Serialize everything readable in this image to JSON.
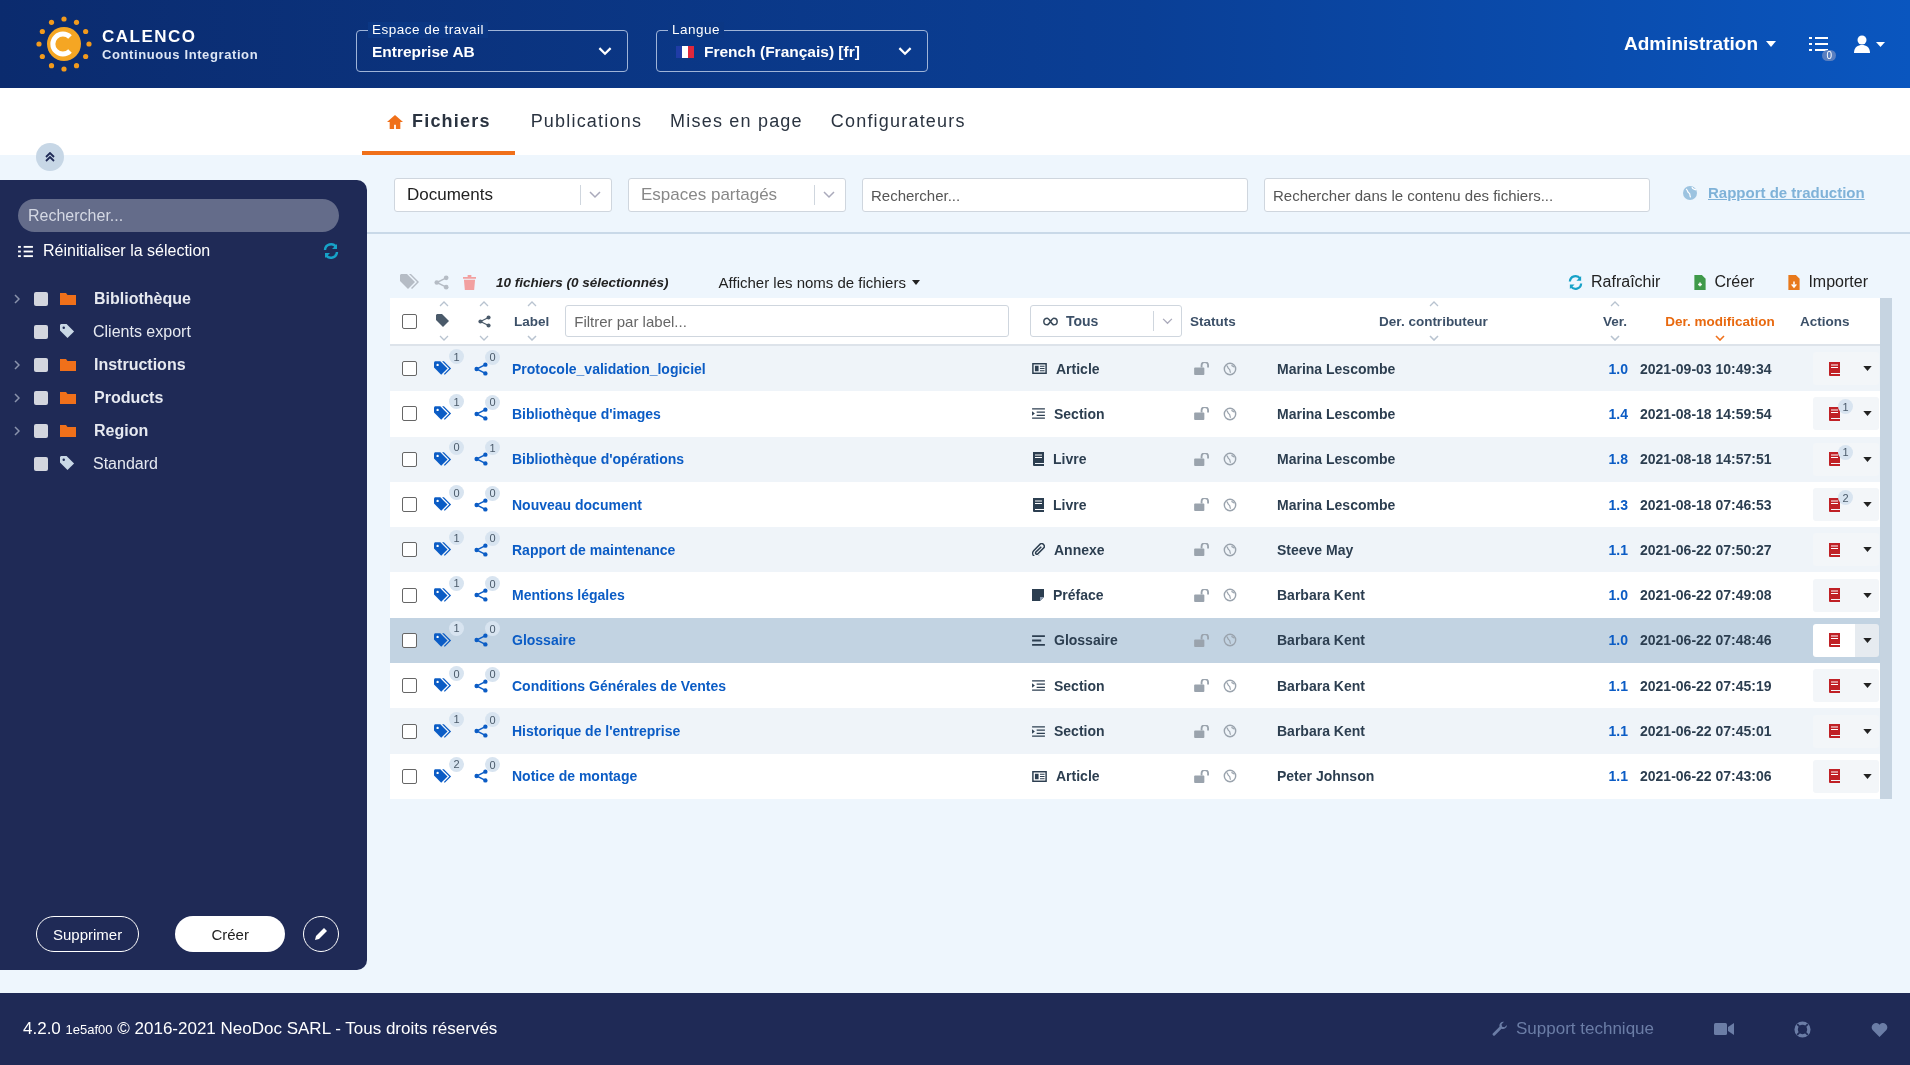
{
  "header": {
    "logo": {
      "name": "CALENCO",
      "subtitle": "Continuous Integration"
    },
    "workspace": {
      "label": "Espace de travail",
      "value": "Entreprise AB"
    },
    "language": {
      "label": "Langue",
      "value": "French (Français) [fr]"
    },
    "admin": "Administration",
    "tasks_count": "0"
  },
  "tabs": [
    {
      "label": "Fichiers",
      "selected": true,
      "kind": "home"
    },
    {
      "label": "Publications",
      "selected": false,
      "kind": "plain"
    },
    {
      "label": "Mises en page",
      "selected": false,
      "kind": "plain"
    },
    {
      "label": "Configurateurs",
      "selected": false,
      "kind": "plain"
    }
  ],
  "sidebar": {
    "search_placeholder": "Rechercher...",
    "reset": "Réinitialiser la sélection",
    "items": [
      {
        "label": "Bibliothèque",
        "kind": "folder",
        "expandable": true,
        "checked": false
      },
      {
        "label": "Clients export",
        "kind": "tag",
        "expandable": false,
        "checked": false
      },
      {
        "label": "Instructions",
        "kind": "folder",
        "expandable": true,
        "checked": false
      },
      {
        "label": "Products",
        "kind": "folder",
        "expandable": true,
        "checked": false
      },
      {
        "label": "Region",
        "kind": "folder",
        "expandable": true,
        "checked": false
      },
      {
        "label": "Standard",
        "kind": "tag",
        "expandable": false,
        "checked": false
      }
    ],
    "buttons": {
      "delete": "Supprimer",
      "create": "Créer"
    }
  },
  "filters": {
    "documents": "Documents",
    "spaces": "Espaces partagés",
    "search_placeholder": "Rechercher...",
    "content_placeholder": "Rechercher dans le contenu des fichiers...",
    "report_link": "Rapport de traduction"
  },
  "toolbar": {
    "count": "10 fichiers (0 sélectionnés)",
    "display": "Afficher les noms de fichiers",
    "refresh": "Rafraîchir",
    "create": "Créer",
    "import": "Importer"
  },
  "table": {
    "header": {
      "select_all_checked": false,
      "label": {
        "text": "Label",
        "sorted": false
      },
      "label_filter_placeholder": "Filtrer par label...",
      "type_filter": "Tous",
      "statuses": "Statuts",
      "contributor": {
        "text": "Der. contributeur",
        "sorted": false
      },
      "version": {
        "text": "Ver.",
        "sorted": false
      },
      "modified": {
        "text": "Der. modification",
        "sorted": true
      },
      "actions": "Actions"
    },
    "rows": [
      {
        "name": "Protocole_validation_logiciel",
        "tags": "1",
        "shares": "0",
        "type": {
          "kind": "article",
          "label": "Article"
        },
        "contributor": "Marina Lescombe",
        "version": "1.0",
        "modified": "2021-09-03 10:49:34",
        "checked": false,
        "selected": false
      },
      {
        "name": "Bibliothèque d'images",
        "tags": "1",
        "shares": "0",
        "type": {
          "kind": "section",
          "label": "Section"
        },
        "contributor": "Marina Lescombe",
        "version": "1.4",
        "modified": "2021-08-18 14:59:54",
        "action_badge": "1",
        "checked": false,
        "selected": false
      },
      {
        "name": "Bibliothèque d'opérations",
        "tags": "0",
        "shares": "1",
        "type": {
          "kind": "book",
          "label": "Livre"
        },
        "contributor": "Marina Lescombe",
        "version": "1.8",
        "modified": "2021-08-18 14:57:51",
        "action_badge": "1",
        "checked": false,
        "selected": false
      },
      {
        "name": "Nouveau document",
        "tags": "0",
        "shares": "0",
        "type": {
          "kind": "book",
          "label": "Livre"
        },
        "contributor": "Marina Lescombe",
        "version": "1.3",
        "modified": "2021-08-18 07:46:53",
        "action_badge": "2",
        "checked": false,
        "selected": false
      },
      {
        "name": "Rapport de maintenance",
        "tags": "1",
        "shares": "0",
        "type": {
          "kind": "annex",
          "label": "Annexe"
        },
        "contributor": "Steeve May",
        "version": "1.1",
        "modified": "2021-06-22 07:50:27",
        "checked": false,
        "selected": false
      },
      {
        "name": "Mentions légales",
        "tags": "1",
        "shares": "0",
        "type": {
          "kind": "preface",
          "label": "Préface"
        },
        "contributor": "Barbara Kent",
        "version": "1.0",
        "modified": "2021-06-22 07:49:08",
        "checked": false,
        "selected": false
      },
      {
        "name": "Glossaire",
        "tags": "1",
        "shares": "0",
        "type": {
          "kind": "glossary",
          "label": "Glossaire"
        },
        "contributor": "Barbara Kent",
        "version": "1.0",
        "modified": "2021-06-22 07:48:46",
        "checked": false,
        "selected": true
      },
      {
        "name": "Conditions Générales de Ventes",
        "tags": "0",
        "shares": "0",
        "type": {
          "kind": "section",
          "label": "Section"
        },
        "contributor": "Barbara Kent",
        "version": "1.1",
        "modified": "2021-06-22 07:45:19",
        "checked": false,
        "selected": false
      },
      {
        "name": "Historique de l'entreprise",
        "tags": "1",
        "shares": "0",
        "type": {
          "kind": "section",
          "label": "Section"
        },
        "contributor": "Barbara Kent",
        "version": "1.1",
        "modified": "2021-06-22 07:45:01",
        "checked": false,
        "selected": false
      },
      {
        "name": "Notice de montage",
        "tags": "2",
        "shares": "0",
        "type": {
          "kind": "article",
          "label": "Article"
        },
        "contributor": "Peter Johnson",
        "version": "1.1",
        "modified": "2021-06-22 07:43:06",
        "checked": false,
        "selected": false
      }
    ]
  },
  "footer": {
    "version": "4.2.0",
    "build": "1e5af00",
    "copyright": "© 2016-2021 NeoDoc SARL - Tous droits réservés",
    "support": "Support technique"
  }
}
